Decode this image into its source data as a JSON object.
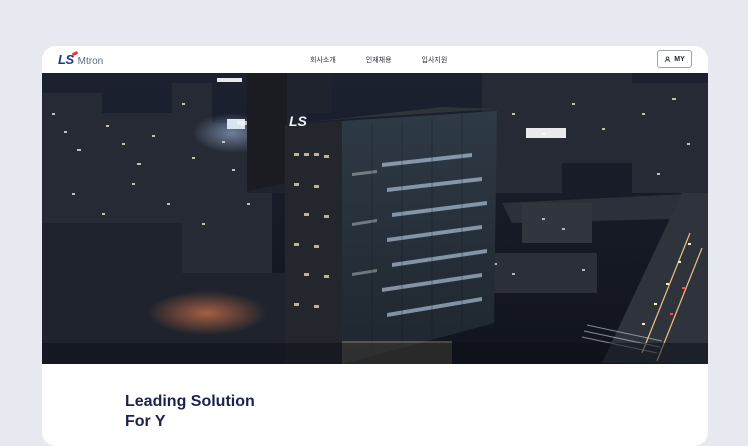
{
  "brand": {
    "logo_ls": "LS",
    "logo_name": "Mtron",
    "building_sign": "LS"
  },
  "nav": {
    "items": [
      {
        "label": "회사소개"
      },
      {
        "label": "인재채용"
      },
      {
        "label": "입사지원"
      }
    ]
  },
  "header": {
    "my_button_label": "MY"
  },
  "hero": {
    "tagline_line1": "Leading Solution",
    "tagline_line2": "For Y",
    "image_description": ""
  },
  "colors": {
    "brand_navy": "#1d3a8a",
    "brand_red": "#e53935",
    "tagline": "#1a2350",
    "page_bg": "#e6e9ef"
  }
}
